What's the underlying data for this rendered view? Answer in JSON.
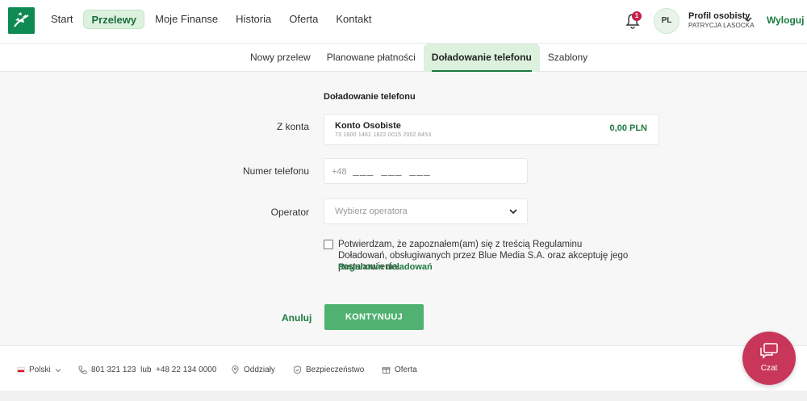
{
  "header": {
    "nav": [
      "Start",
      "Przelewy",
      "Moje Finanse",
      "Historia",
      "Oferta",
      "Kontakt"
    ],
    "active_nav": "Przelewy",
    "notifications_count": "1",
    "avatar_initials": "PL",
    "profile_name": "Profil osobisty",
    "profile_user": "PATRYCJA LASOCKA",
    "logout": "Wyloguj"
  },
  "subnav": {
    "tabs": [
      "Nowy przelew",
      "Planowane płatności",
      "Doładowanie telefonu",
      "Szablony"
    ],
    "active_tab": "Doładowanie telefonu"
  },
  "form": {
    "title": "Doładowanie telefonu",
    "from_label": "Z konta",
    "account_name": "Konto Osobiste",
    "account_number": "73 1600 1462 1822 0015 2002 8453",
    "account_balance": "0,00 PLN",
    "phone_label": "Numer telefonu",
    "phone_prefix": "+48",
    "phone_mask": "___ ___ ___",
    "operator_label": "Operator",
    "operator_placeholder": "Wybierz operatora",
    "consent_text": "Potwierdzam, że zapoznałem(am) się z treścią Regulaminu Doładowań, obsługiwanych przez Blue Media S.A. oraz akceptuję jego postanowienia.",
    "consent_link": "Regulamin doładowań",
    "cancel": "Anuluj",
    "continue": "KONTYNUUJ"
  },
  "footer": {
    "language": "Polski",
    "phone": "801 321 123  lub  +48 22 134 0000",
    "branches": "Oddziały",
    "security": "Bezpieczeństwo",
    "offer": "Oferta"
  },
  "chat": {
    "label": "Czat"
  },
  "colors": {
    "brand": "#1b7a3e",
    "button": "#4fb270",
    "chat": "#c8375a",
    "badge": "#c81e46"
  }
}
